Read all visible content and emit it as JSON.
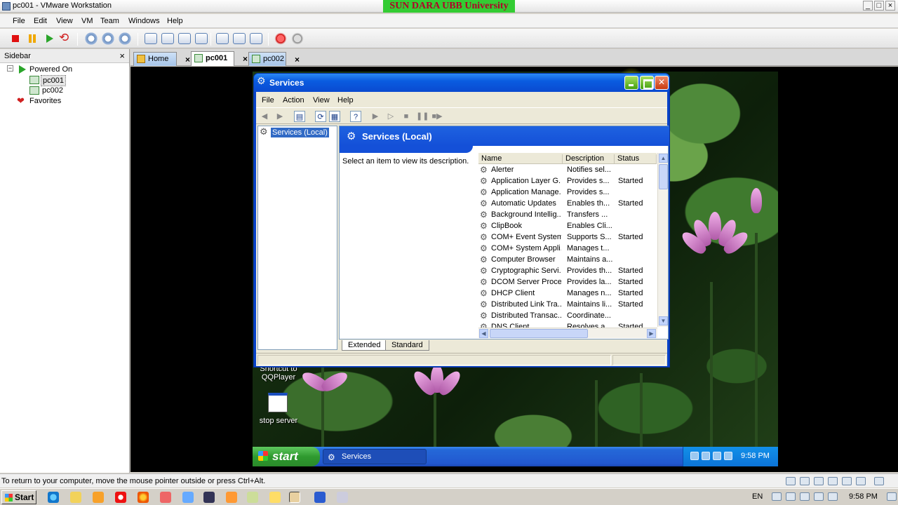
{
  "vmware": {
    "title": "pc001 - VMware Workstation",
    "banner": "SUN DARA UBB University",
    "menu": [
      "File",
      "Edit",
      "View",
      "VM",
      "Team",
      "Windows",
      "Help"
    ],
    "window_controls": {
      "minimize": "_",
      "maximize": "□",
      "close": "×"
    },
    "sidebar": {
      "title": "Sidebar",
      "close": "×",
      "expander": "−",
      "group": "Powered On",
      "vms": [
        "pc001",
        "pc002"
      ],
      "favorites": "Favorites"
    },
    "tabs": [
      {
        "label": "Home",
        "close": "×"
      },
      {
        "label": "pc001",
        "close": "×",
        "active": true
      },
      {
        "label": "pc002",
        "close": "×"
      }
    ],
    "status_message": "To return to your computer, move the mouse pointer outside or press Ctrl+Alt."
  },
  "services_window": {
    "title": "Services",
    "menu": [
      "File",
      "Action",
      "View",
      "Help"
    ],
    "tree_root": "Services (Local)",
    "header_title": "Services (Local)",
    "description_hint": "Select an item to view its description.",
    "columns": [
      "Name",
      "Description",
      "Status"
    ],
    "rows": [
      {
        "name": "Alerter",
        "description": "Notifies sel...",
        "status": ""
      },
      {
        "name": "Application Layer G...",
        "description": "Provides s...",
        "status": "Started"
      },
      {
        "name": "Application Manage...",
        "description": "Provides s...",
        "status": ""
      },
      {
        "name": "Automatic Updates",
        "description": "Enables th...",
        "status": "Started"
      },
      {
        "name": "Background Intellig...",
        "description": "Transfers ...",
        "status": ""
      },
      {
        "name": "ClipBook",
        "description": "Enables Cli...",
        "status": ""
      },
      {
        "name": "COM+ Event System",
        "description": "Supports S...",
        "status": "Started"
      },
      {
        "name": "COM+ System Appli...",
        "description": "Manages t...",
        "status": ""
      },
      {
        "name": "Computer Browser",
        "description": "Maintains a...",
        "status": ""
      },
      {
        "name": "Cryptographic Servi...",
        "description": "Provides th...",
        "status": "Started"
      },
      {
        "name": "DCOM Server Proce...",
        "description": "Provides la...",
        "status": "Started"
      },
      {
        "name": "DHCP Client",
        "description": "Manages n...",
        "status": "Started"
      },
      {
        "name": "Distributed Link Tra...",
        "description": "Maintains li...",
        "status": "Started"
      },
      {
        "name": "Distributed Transac...",
        "description": "Coordinate...",
        "status": ""
      },
      {
        "name": "DNS Client",
        "description": "Resolves a...",
        "status": "Started"
      }
    ],
    "view_tabs": [
      "Extended",
      "Standard"
    ]
  },
  "guest_desktop": {
    "icons": [
      {
        "label": "Shortcut to QQPlayer"
      },
      {
        "label": "stop server"
      }
    ],
    "start_label": "start",
    "task_label": "Services",
    "clock": "9:58 PM"
  },
  "host_taskbar": {
    "start_label": "Start",
    "language": "EN",
    "clock": "9:58 PM"
  }
}
